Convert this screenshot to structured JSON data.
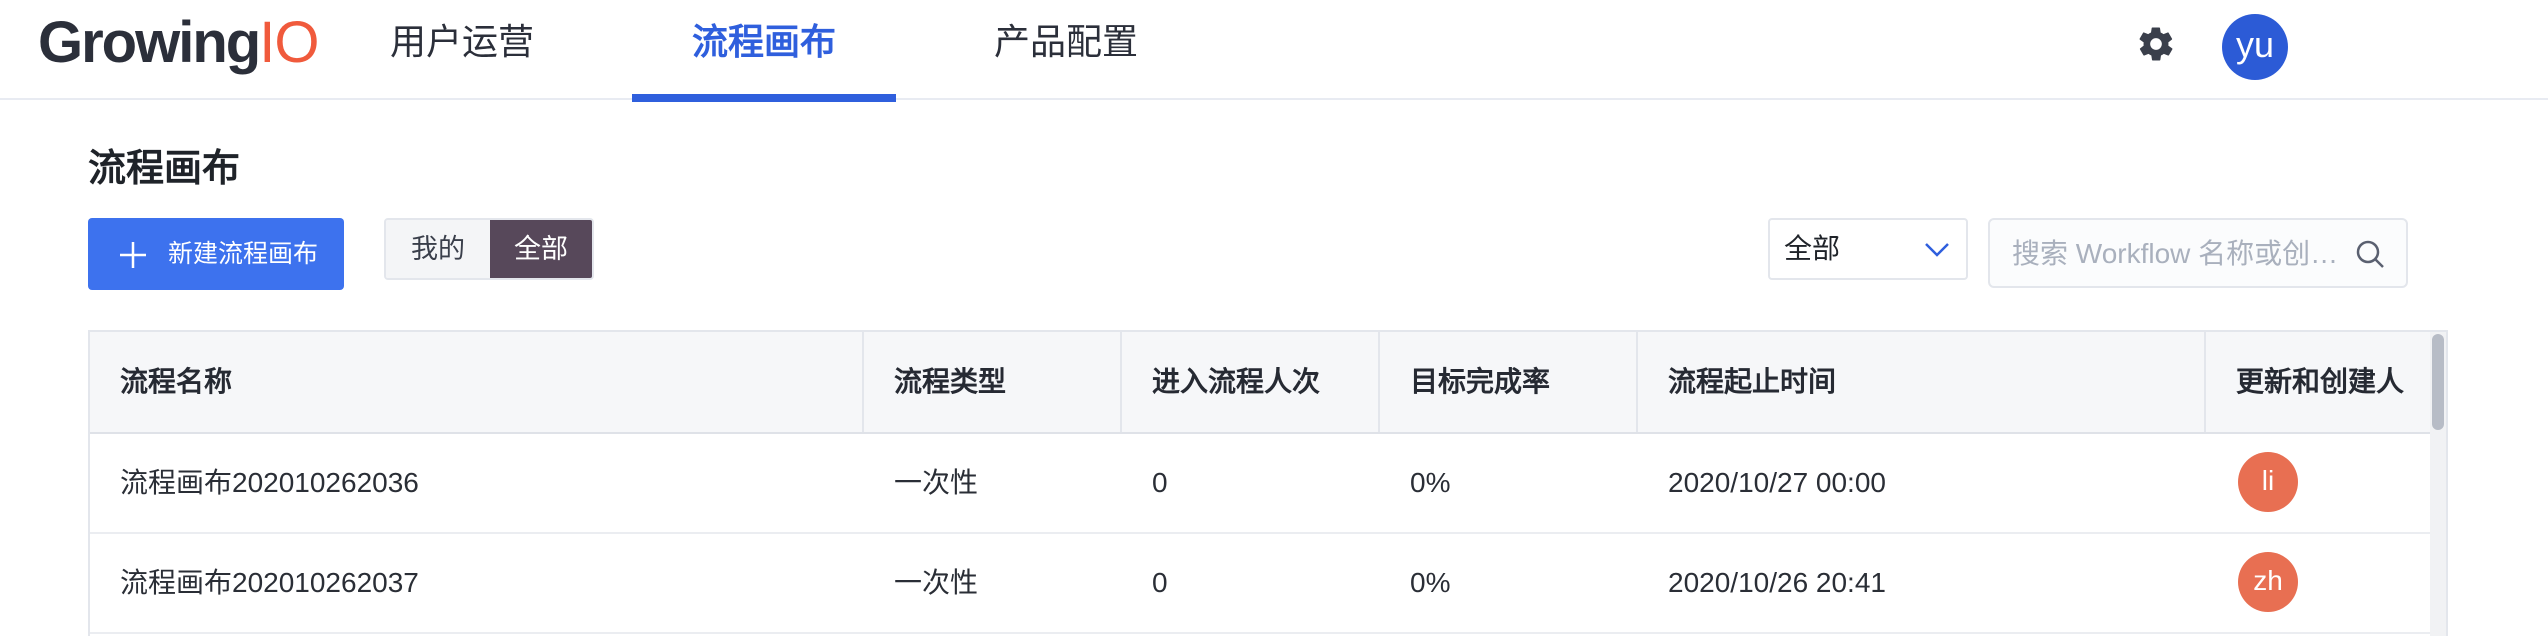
{
  "nav": {
    "logo_main": "Growing",
    "logo_accent": "IO",
    "tabs": [
      {
        "label": "用户运营",
        "active": false
      },
      {
        "label": "流程画布",
        "active": true
      },
      {
        "label": "产品配置",
        "active": false
      }
    ],
    "settings_icon": "gear-icon",
    "user_initials": "yu",
    "accent_color": "#2f5fdd"
  },
  "page": {
    "title": "流程画布",
    "new_button_label": "新建流程画布",
    "filter_tabs": [
      {
        "label": "我的",
        "active": false
      },
      {
        "label": "全部",
        "active": true
      }
    ],
    "status_select_value": "全部",
    "search_placeholder": "搜索 Workflow 名称或创…"
  },
  "table": {
    "columns": [
      "流程名称",
      "流程类型",
      "进入流程人次",
      "目标完成率",
      "流程起止时间",
      "更新和创建人"
    ],
    "rows": [
      {
        "name": "流程画布202010262036",
        "type": "一次性",
        "entries": "0",
        "rate": "0%",
        "time": "2020/10/27 00:00",
        "user": "li"
      },
      {
        "name": "流程画布202010262037",
        "type": "一次性",
        "entries": "0",
        "rate": "0%",
        "time": "2020/10/26 20:41",
        "user": "zh"
      }
    ],
    "avatar_color": "#e86f52"
  }
}
